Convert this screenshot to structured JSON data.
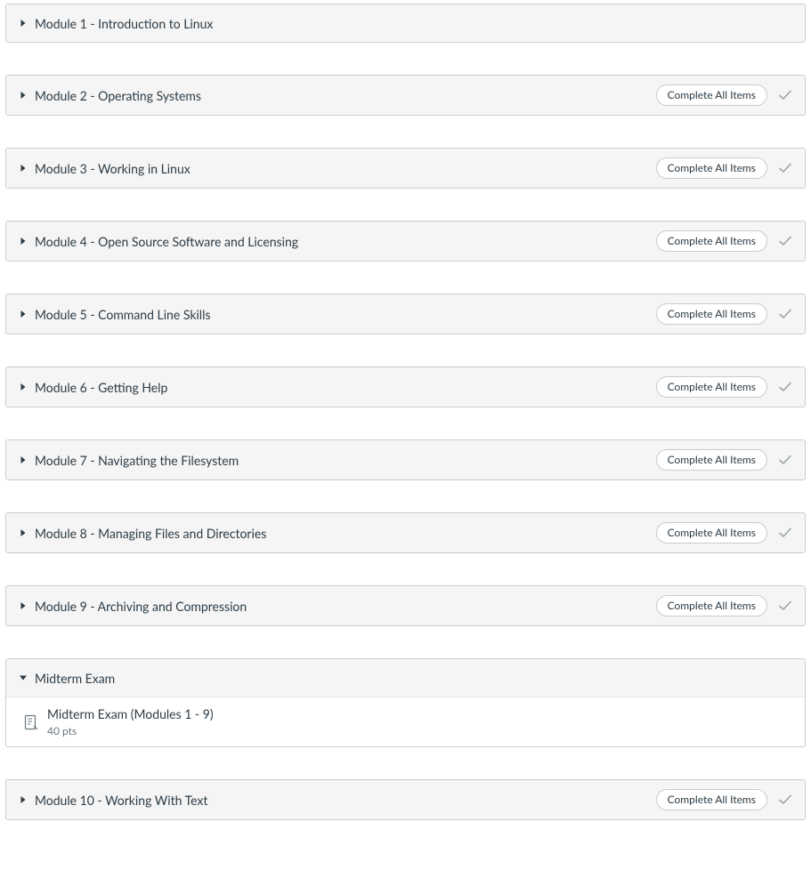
{
  "complete_label": "Complete All Items",
  "modules": [
    {
      "title": "Module 1 - Introduction to Linux",
      "show_pill": false,
      "show_check": false,
      "expanded": false
    },
    {
      "title": "Module 2 - Operating Systems",
      "show_pill": true,
      "show_check": true,
      "expanded": false
    },
    {
      "title": "Module 3 - Working in Linux",
      "show_pill": true,
      "show_check": true,
      "expanded": false
    },
    {
      "title": "Module 4 - Open Source Software and Licensing",
      "show_pill": true,
      "show_check": true,
      "expanded": false
    },
    {
      "title": "Module 5 - Command Line Skills",
      "show_pill": true,
      "show_check": true,
      "expanded": false
    },
    {
      "title": "Module 6 - Getting Help",
      "show_pill": true,
      "show_check": true,
      "expanded": false
    },
    {
      "title": "Module 7 - Navigating the Filesystem",
      "show_pill": true,
      "show_check": true,
      "expanded": false
    },
    {
      "title": "Module 8 - Managing Files and Directories",
      "show_pill": true,
      "show_check": true,
      "expanded": false
    },
    {
      "title": "Module 9 - Archiving and Compression",
      "show_pill": true,
      "show_check": true,
      "expanded": false
    },
    {
      "title": "Midterm Exam",
      "show_pill": false,
      "show_check": false,
      "expanded": true,
      "items": [
        {
          "type": "quiz",
          "title": "Midterm Exam (Modules 1 - 9)",
          "sub": "40 pts"
        }
      ]
    },
    {
      "title": "Module 10 - Working With Text",
      "show_pill": true,
      "show_check": true,
      "expanded": false
    }
  ]
}
